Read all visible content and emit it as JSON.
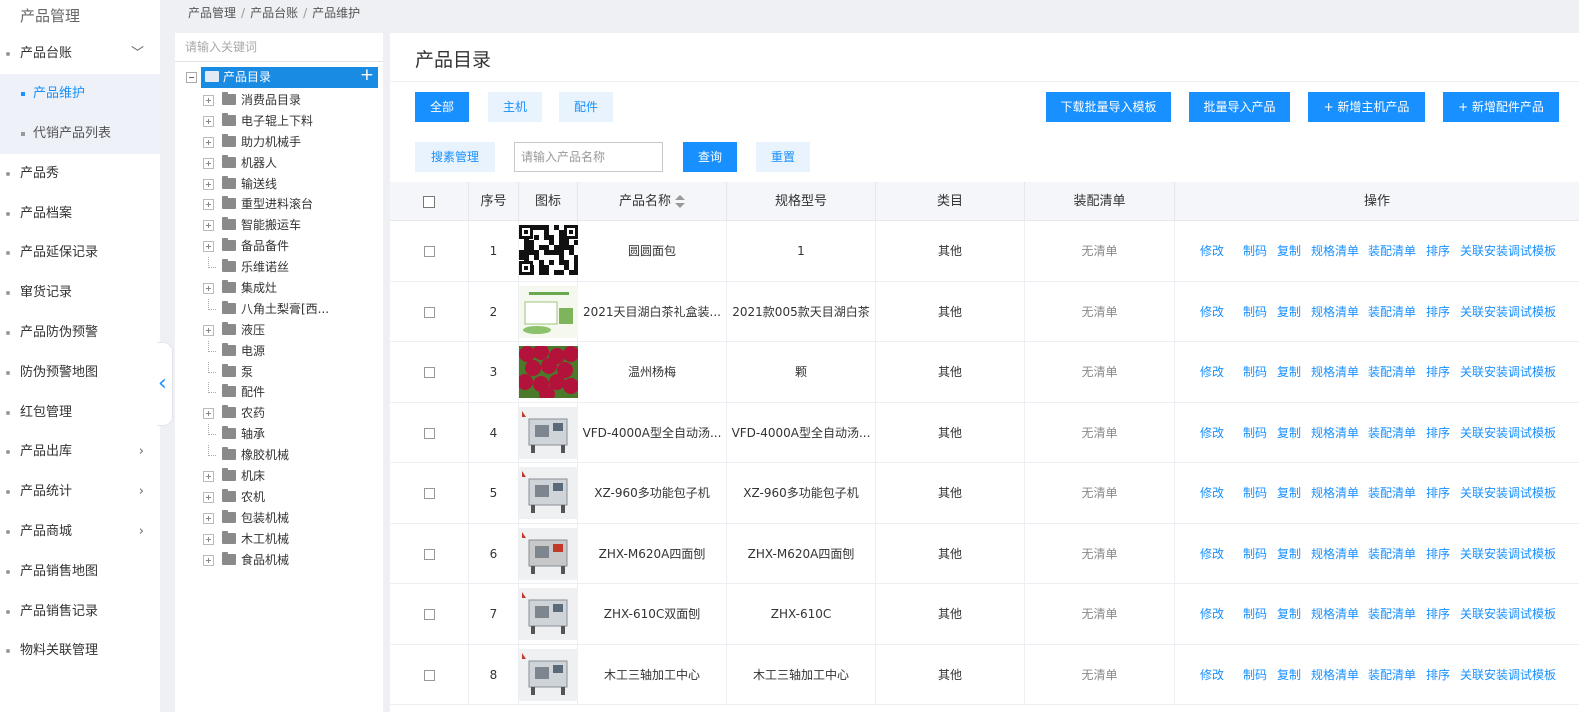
{
  "sidebar": {
    "title": "产品管理",
    "menu_ledger": "产品台账",
    "sub_maintain": "产品维护",
    "sub_consign": "代销产品列表",
    "items": [
      {
        "label": "产品秀",
        "chevron": false
      },
      {
        "label": "产品档案",
        "chevron": false
      },
      {
        "label": "产品延保记录",
        "chevron": false
      },
      {
        "label": "窜货记录",
        "chevron": false
      },
      {
        "label": "产品防伪预警",
        "chevron": false
      },
      {
        "label": "防伪预警地图",
        "chevron": false
      },
      {
        "label": "红包管理",
        "chevron": false
      },
      {
        "label": "产品出库",
        "chevron": true
      },
      {
        "label": "产品统计",
        "chevron": true
      },
      {
        "label": "产品商城",
        "chevron": true
      },
      {
        "label": "产品销售地图",
        "chevron": false
      },
      {
        "label": "产品销售记录",
        "chevron": false
      },
      {
        "label": "物料关联管理",
        "chevron": false
      }
    ]
  },
  "breadcrumb": {
    "level1": "产品管理",
    "level2": "产品台账",
    "level3": "产品维护"
  },
  "tree": {
    "search_placeholder": "请输入关键词",
    "root_label": "产品目录",
    "nodes": [
      {
        "label": "消费品目录",
        "expandable": true
      },
      {
        "label": "电子辊上下料",
        "expandable": true
      },
      {
        "label": "助力机械手",
        "expandable": true
      },
      {
        "label": "机器人",
        "expandable": true
      },
      {
        "label": "输送线",
        "expandable": true
      },
      {
        "label": "重型进料滚台",
        "expandable": true
      },
      {
        "label": "智能搬运车",
        "expandable": true
      },
      {
        "label": "备品备件",
        "expandable": true
      },
      {
        "label": "乐维诺丝",
        "expandable": false
      },
      {
        "label": "集成灶",
        "expandable": true
      },
      {
        "label": "八角土梨膏[西...",
        "expandable": false
      },
      {
        "label": "液压",
        "expandable": true
      },
      {
        "label": "电源",
        "expandable": false
      },
      {
        "label": "泵",
        "expandable": false
      },
      {
        "label": "配件",
        "expandable": false
      },
      {
        "label": "农药",
        "expandable": true
      },
      {
        "label": "轴承",
        "expandable": false
      },
      {
        "label": "橡胶机械",
        "expandable": false
      },
      {
        "label": "机床",
        "expandable": true
      },
      {
        "label": "农机",
        "expandable": true
      },
      {
        "label": "包装机械",
        "expandable": true
      },
      {
        "label": "木工机械",
        "expandable": true
      },
      {
        "label": "食品机械",
        "expandable": true
      }
    ]
  },
  "main": {
    "title": "产品目录",
    "filter_all": "全部",
    "filter_host": "主机",
    "filter_parts": "配件",
    "btn_download_template": "下载批量导入模板",
    "btn_batch_import": "批量导入产品",
    "btn_add_host": "+ 新增主机产品",
    "btn_add_parts": "+ 新增配件产品",
    "btn_search_manage": "搜素管理",
    "search_placeholder": "请输入产品名称",
    "btn_query": "查询",
    "btn_reset": "重置"
  },
  "table": {
    "headers": {
      "index": "序号",
      "icon": "图标",
      "name": "产品名称",
      "spec": "规格型号",
      "category": "类目",
      "assembly": "装配清单",
      "ops": "操作"
    },
    "op_labels": {
      "edit": "修改",
      "code": "制码",
      "copy": "复制",
      "spec_list": "规格清单",
      "assembly_list": "装配清单",
      "sort": "排序",
      "link_template": "关联安装调试模板"
    },
    "rows": [
      {
        "index": "1",
        "name": "圆圆面包",
        "spec": "1",
        "category": "其他",
        "assembly": "无清单",
        "thumb": "qrcode"
      },
      {
        "index": "2",
        "name": "2021天目湖白茶礼盒装...",
        "spec": "2021款005款天目湖白茶",
        "category": "其他",
        "assembly": "无清单",
        "thumb": "tea"
      },
      {
        "index": "3",
        "name": "温州杨梅",
        "spec": "颗",
        "category": "其他",
        "assembly": "无清单",
        "thumb": "berry"
      },
      {
        "index": "4",
        "name": "VFD-4000A型全自动汤...",
        "spec": "VFD-4000A型全自动汤...",
        "category": "其他",
        "assembly": "无清单",
        "thumb": "machine"
      },
      {
        "index": "5",
        "name": "XZ-960多功能包子机",
        "spec": "XZ-960多功能包子机",
        "category": "其他",
        "assembly": "无清单",
        "thumb": "machine"
      },
      {
        "index": "6",
        "name": "ZHX-M620A四面刨",
        "spec": "ZHX-M620A四面刨",
        "category": "其他",
        "assembly": "无清单",
        "thumb": "machine-red"
      },
      {
        "index": "7",
        "name": "ZHX-610C双面刨",
        "spec": "ZHX-610C",
        "category": "其他",
        "assembly": "无清单",
        "thumb": "machine"
      },
      {
        "index": "8",
        "name": "木工三轴加工中心",
        "spec": "木工三轴加工中心",
        "category": "其他",
        "assembly": "无清单",
        "thumb": "machine"
      }
    ]
  },
  "colors": {
    "accent": "#1890ff",
    "sidebar_sub_bg": "#eef2f8",
    "tree_selected": "#1a8be2"
  }
}
